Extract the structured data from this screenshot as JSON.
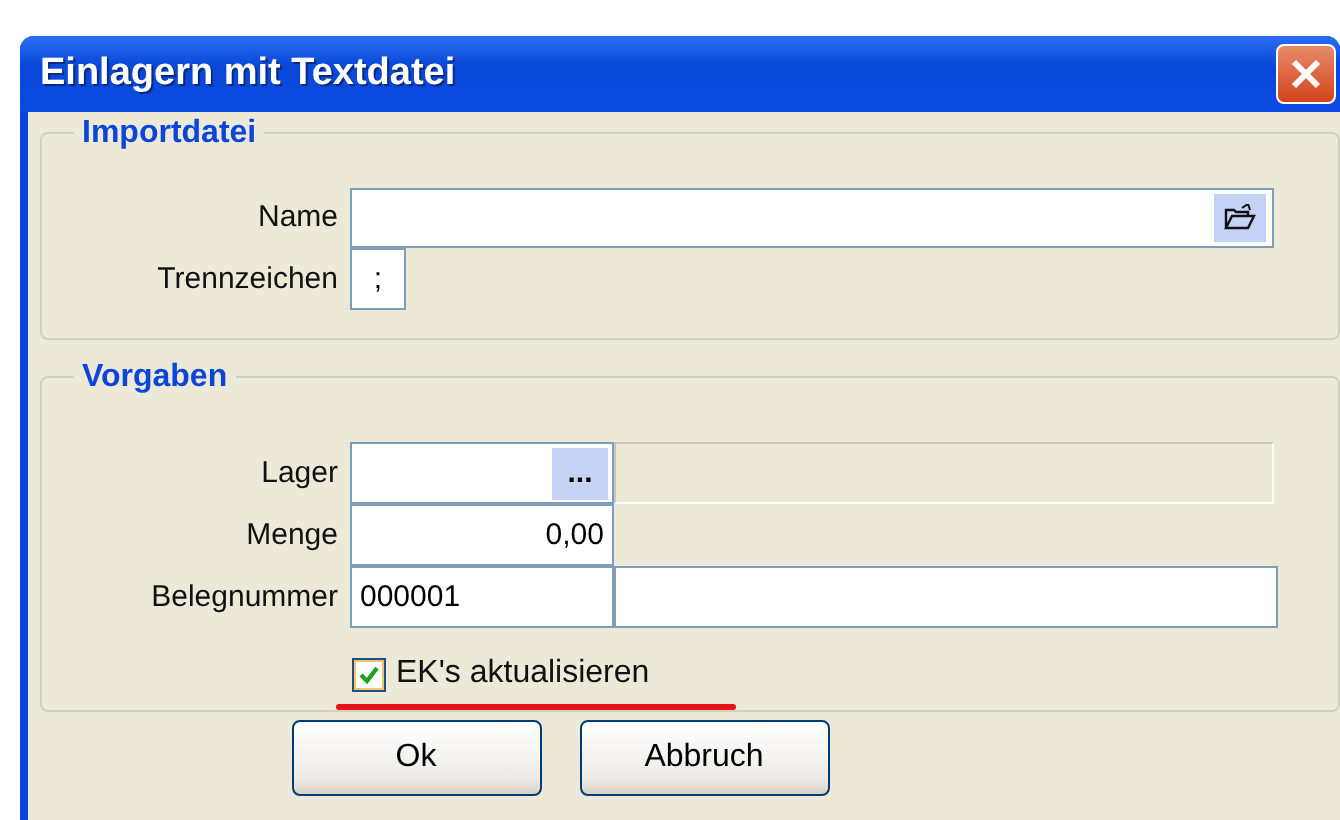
{
  "window": {
    "title": "Einlagern mit Textdatei"
  },
  "import_group": {
    "title": "Importdatei",
    "name_label": "Name",
    "separator_label": "Trennzeichen",
    "separator_value": ";"
  },
  "defaults_group": {
    "title": "Vorgaben",
    "lager_label": "Lager",
    "lager_button": "...",
    "menge_label": "Menge",
    "menge_value": "0,00",
    "beleg_label": "Belegnummer",
    "beleg_value": "000001"
  },
  "checkbox": {
    "label": "EK's aktualisieren",
    "checked": true
  },
  "buttons": [
    "Ok",
    "Abbruch"
  ]
}
